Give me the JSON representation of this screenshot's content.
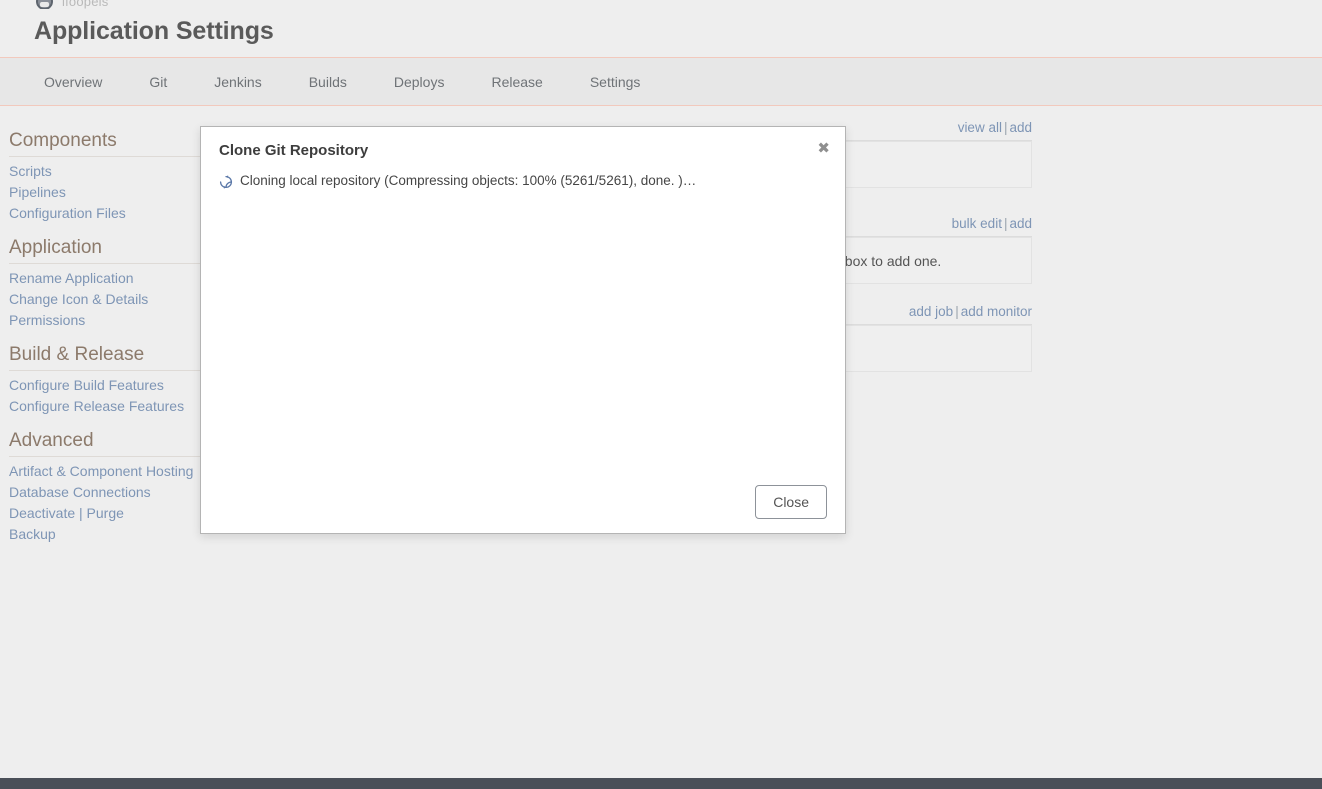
{
  "topbar": {
    "breadcrumb_text": "ifoopeis",
    "logo_icon": "app-avatar-icon"
  },
  "header": {
    "title": "Application Settings"
  },
  "nav": {
    "tabs": [
      {
        "label": "Overview"
      },
      {
        "label": "Git"
      },
      {
        "label": "Jenkins"
      },
      {
        "label": "Builds"
      },
      {
        "label": "Deploys"
      },
      {
        "label": "Release"
      },
      {
        "label": "Settings"
      }
    ]
  },
  "sidebar": {
    "groups": [
      {
        "heading": "Components",
        "links": [
          {
            "label": "Scripts"
          },
          {
            "label": "Pipelines"
          },
          {
            "label": "Configuration Files"
          }
        ]
      },
      {
        "heading": "Application",
        "links": [
          {
            "label": "Rename Application"
          },
          {
            "label": "Change Icon & Details"
          },
          {
            "label": "Permissions"
          }
        ]
      },
      {
        "heading": "Build & Release",
        "links": [
          {
            "label": "Configure Build Features"
          },
          {
            "label": "Configure Release Features"
          }
        ]
      },
      {
        "heading": "Advanced",
        "links": [
          {
            "label": "Artifact & Component Hosting"
          },
          {
            "label": "Database Connections"
          },
          {
            "label": "Deactivate | Purge"
          },
          {
            "label": "Backup"
          }
        ]
      }
    ]
  },
  "content": {
    "panels": [
      {
        "actions": [
          "view all",
          "add"
        ],
        "delete_icon": "✖",
        "empty_text": ""
      },
      {
        "actions": [
          "bulk edit",
          "add"
        ],
        "delete_icon": "",
        "empty_text": "r of this box to add one."
      },
      {
        "actions": [
          "add job",
          "add monitor"
        ],
        "delete_icon": "✖",
        "empty_text": ""
      }
    ]
  },
  "modal": {
    "title": "Clone Git Repository",
    "close_icon": "✖",
    "spinner_icon": "loading-spinner-icon",
    "status_text": "Cloning local repository (Compressing objects: 100% (5261/5261), done. )…",
    "progress_percent": "100%",
    "objects_compressed": "5261/5261",
    "close_button_label": "Close"
  },
  "colors": {
    "page_bg": "#eeeeee",
    "nav_bg": "#e7e7e7",
    "nav_border": "#f2c9bd",
    "heading_text": "#8c7a6b",
    "link_text": "#7e95b5",
    "title_text": "#5a5a5a",
    "footer_bar": "#4a4f58",
    "delete_icon": "#e49a97",
    "spinner": "#5b78a8"
  }
}
